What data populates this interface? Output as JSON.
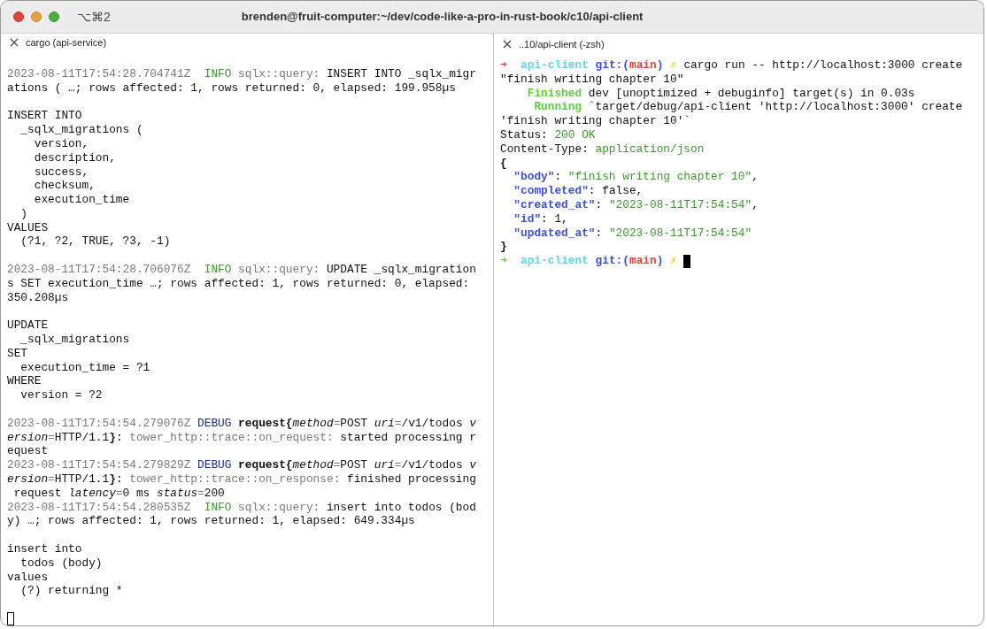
{
  "window": {
    "shortcut": "⌥⌘2",
    "title": "brenden@fruit-computer:~/dev/code-like-a-pro-in-rust-book/c10/api-client"
  },
  "panes": [
    {
      "tab": "cargo (api-service)",
      "cursor": {
        "focused": false
      },
      "blocks": [
        {
          "lines": [
            [
              {
                "text": "2023-08-11T17:54:28.704741Z ",
                "kind": "dim"
              },
              {
                "text": " INFO ",
                "kind": "info"
              },
              {
                "text": "sqlx::query:",
                "kind": "dim"
              },
              {
                "text": " INSERT INTO _sqlx_migr",
                "kind": "plain"
              }
            ],
            [
              {
                "text": "ations ( …; rows affected: 1, rows returned: 0, elapsed: 199.958µs",
                "kind": "plain"
              }
            ]
          ]
        },
        {
          "lines": [
            [
              {
                "text": "INSERT INTO",
                "kind": "plain"
              }
            ],
            [
              {
                "text": "  _sqlx_migrations (",
                "kind": "plain"
              }
            ],
            [
              {
                "text": "    version,",
                "kind": "plain"
              }
            ],
            [
              {
                "text": "    description,",
                "kind": "plain"
              }
            ],
            [
              {
                "text": "    success,",
                "kind": "plain"
              }
            ],
            [
              {
                "text": "    checksum,",
                "kind": "plain"
              }
            ],
            [
              {
                "text": "    execution_time",
                "kind": "plain"
              }
            ],
            [
              {
                "text": "  )",
                "kind": "plain"
              }
            ],
            [
              {
                "text": "VALUES",
                "kind": "plain"
              }
            ],
            [
              {
                "text": "  (?1, ?2, TRUE, ?3, -1)",
                "kind": "plain"
              }
            ]
          ]
        },
        {
          "lines": [
            [
              {
                "text": "2023-08-11T17:54:28.706076Z ",
                "kind": "dim"
              },
              {
                "text": " INFO ",
                "kind": "info"
              },
              {
                "text": "sqlx::query:",
                "kind": "dim"
              },
              {
                "text": " UPDATE _sqlx_migration",
                "kind": "plain"
              }
            ],
            [
              {
                "text": "s SET execution_time …; rows affected: 1, rows returned: 0, elapsed:",
                "kind": "plain"
              }
            ],
            [
              {
                "text": "350.208µs",
                "kind": "plain"
              }
            ]
          ]
        },
        {
          "lines": [
            [
              {
                "text": "UPDATE",
                "kind": "plain"
              }
            ],
            [
              {
                "text": "  _sqlx_migrations",
                "kind": "plain"
              }
            ],
            [
              {
                "text": "SET",
                "kind": "plain"
              }
            ],
            [
              {
                "text": "  execution_time = ?1",
                "kind": "plain"
              }
            ],
            [
              {
                "text": "WHERE",
                "kind": "plain"
              }
            ],
            [
              {
                "text": "  version = ?2",
                "kind": "plain"
              }
            ]
          ]
        },
        {
          "lines": [
            [
              {
                "text": "2023-08-11T17:54:54.279076Z ",
                "kind": "dim"
              },
              {
                "text": "DEBUG ",
                "kind": "debug"
              },
              {
                "text": "request{",
                "kind": "bold"
              },
              {
                "text": "method",
                "kind": "italic"
              },
              {
                "text": "=",
                "kind": "dim"
              },
              {
                "text": "POST ",
                "kind": "plain"
              },
              {
                "text": "uri",
                "kind": "italic"
              },
              {
                "text": "=",
                "kind": "dim"
              },
              {
                "text": "/v1/todos ",
                "kind": "plain"
              },
              {
                "text": "v",
                "kind": "italic"
              }
            ],
            [
              {
                "text": "ersion",
                "kind": "italic"
              },
              {
                "text": "=",
                "kind": "dim"
              },
              {
                "text": "HTTP/1.1",
                "kind": "plain"
              },
              {
                "text": "}",
                "kind": "bold"
              },
              {
                "text": ": ",
                "kind": "plain"
              },
              {
                "text": "tower_http::trace::on_request:",
                "kind": "dim"
              },
              {
                "text": " started processing r",
                "kind": "plain"
              }
            ],
            [
              {
                "text": "equest",
                "kind": "plain"
              }
            ],
            [
              {
                "text": "2023-08-11T17:54:54.279829Z ",
                "kind": "dim"
              },
              {
                "text": "DEBUG ",
                "kind": "debug"
              },
              {
                "text": "request{",
                "kind": "bold"
              },
              {
                "text": "method",
                "kind": "italic"
              },
              {
                "text": "=",
                "kind": "dim"
              },
              {
                "text": "POST ",
                "kind": "plain"
              },
              {
                "text": "uri",
                "kind": "italic"
              },
              {
                "text": "=",
                "kind": "dim"
              },
              {
                "text": "/v1/todos ",
                "kind": "plain"
              },
              {
                "text": "v",
                "kind": "italic"
              }
            ],
            [
              {
                "text": "ersion",
                "kind": "italic"
              },
              {
                "text": "=",
                "kind": "dim"
              },
              {
                "text": "HTTP/1.1",
                "kind": "plain"
              },
              {
                "text": "}",
                "kind": "bold"
              },
              {
                "text": ": ",
                "kind": "plain"
              },
              {
                "text": "tower_http::trace::on_response:",
                "kind": "dim"
              },
              {
                "text": " finished processing",
                "kind": "plain"
              }
            ],
            [
              {
                "text": " request ",
                "kind": "plain"
              },
              {
                "text": "latency",
                "kind": "italic"
              },
              {
                "text": "=",
                "kind": "dim"
              },
              {
                "text": "0 ms ",
                "kind": "plain"
              },
              {
                "text": "status",
                "kind": "italic"
              },
              {
                "text": "=",
                "kind": "dim"
              },
              {
                "text": "200",
                "kind": "plain"
              }
            ],
            [
              {
                "text": "2023-08-11T17:54:54.280535Z ",
                "kind": "dim"
              },
              {
                "text": " INFO ",
                "kind": "info"
              },
              {
                "text": "sqlx::query:",
                "kind": "dim"
              },
              {
                "text": " insert into todos (bod",
                "kind": "plain"
              }
            ],
            [
              {
                "text": "y) …; rows affected: 1, rows returned: 1, elapsed: 649.334µs",
                "kind": "plain"
              }
            ]
          ]
        },
        {
          "lines": [
            [
              {
                "text": "insert into",
                "kind": "plain"
              }
            ],
            [
              {
                "text": "  todos (body)",
                "kind": "plain"
              }
            ],
            [
              {
                "text": "values",
                "kind": "plain"
              }
            ],
            [
              {
                "text": "  (?) returning *",
                "kind": "plain"
              }
            ]
          ]
        }
      ]
    },
    {
      "tab": "..10/api-client (-zsh)",
      "cursor": {
        "focused": true
      },
      "blocks": [
        {
          "lines": [
            [
              {
                "text": "➜",
                "kind": "arrow_red"
              },
              {
                "text": "  api-client ",
                "kind": "cyan"
              },
              {
                "text": "git:(",
                "kind": "git"
              },
              {
                "text": "main",
                "kind": "branch"
              },
              {
                "text": ")",
                "kind": "git"
              },
              {
                "text": " ✗",
                "kind": "yellow"
              },
              {
                "text": " cargo run -- http://localhost:3000 create",
                "kind": "plain"
              }
            ],
            [
              {
                "text": "\"finish writing chapter 10\"",
                "kind": "plain"
              }
            ],
            [
              {
                "text": "    Finished",
                "kind": "cargo"
              },
              {
                "text": " dev [unoptimized + debuginfo] target(s) in 0.03s",
                "kind": "plain"
              }
            ],
            [
              {
                "text": "     Running",
                "kind": "cargo"
              },
              {
                "text": " `target/debug/api-client 'http://localhost:3000' create",
                "kind": "plain"
              }
            ],
            [
              {
                "text": "'finish writing chapter 10'`",
                "kind": "plain"
              }
            ],
            [
              {
                "text": "Status: ",
                "kind": "plain"
              },
              {
                "text": "200 OK",
                "kind": "string"
              }
            ],
            [
              {
                "text": "Content-Type: ",
                "kind": "plain"
              },
              {
                "text": "application/json",
                "kind": "string"
              }
            ],
            [
              {
                "text": "{",
                "kind": "bold"
              }
            ],
            [
              {
                "text": "  \"body\"",
                "kind": "key"
              },
              {
                "text": ": ",
                "kind": "plain"
              },
              {
                "text": "\"finish writing chapter 10\"",
                "kind": "string"
              },
              {
                "text": ",",
                "kind": "plain"
              }
            ],
            [
              {
                "text": "  \"completed\"",
                "kind": "key"
              },
              {
                "text": ": false,",
                "kind": "plain"
              }
            ],
            [
              {
                "text": "  \"created_at\"",
                "kind": "key"
              },
              {
                "text": ": ",
                "kind": "plain"
              },
              {
                "text": "\"2023-08-11T17:54:54\"",
                "kind": "string"
              },
              {
                "text": ",",
                "kind": "plain"
              }
            ],
            [
              {
                "text": "  \"id\"",
                "kind": "key"
              },
              {
                "text": ": 1,",
                "kind": "plain"
              }
            ],
            [
              {
                "text": "  \"updated_at\"",
                "kind": "key"
              },
              {
                "text": ": ",
                "kind": "plain"
              },
              {
                "text": "\"2023-08-11T17:54:54\"",
                "kind": "string"
              }
            ],
            [
              {
                "text": "}",
                "kind": "bold"
              }
            ],
            [
              {
                "text": "➜",
                "kind": "arrow_green"
              },
              {
                "text": "  api-client ",
                "kind": "cyan"
              },
              {
                "text": "git:(",
                "kind": "git"
              },
              {
                "text": "main",
                "kind": "branch"
              },
              {
                "text": ")",
                "kind": "git"
              },
              {
                "text": " ✗ ",
                "kind": "yellow"
              }
            ]
          ]
        }
      ]
    }
  ]
}
